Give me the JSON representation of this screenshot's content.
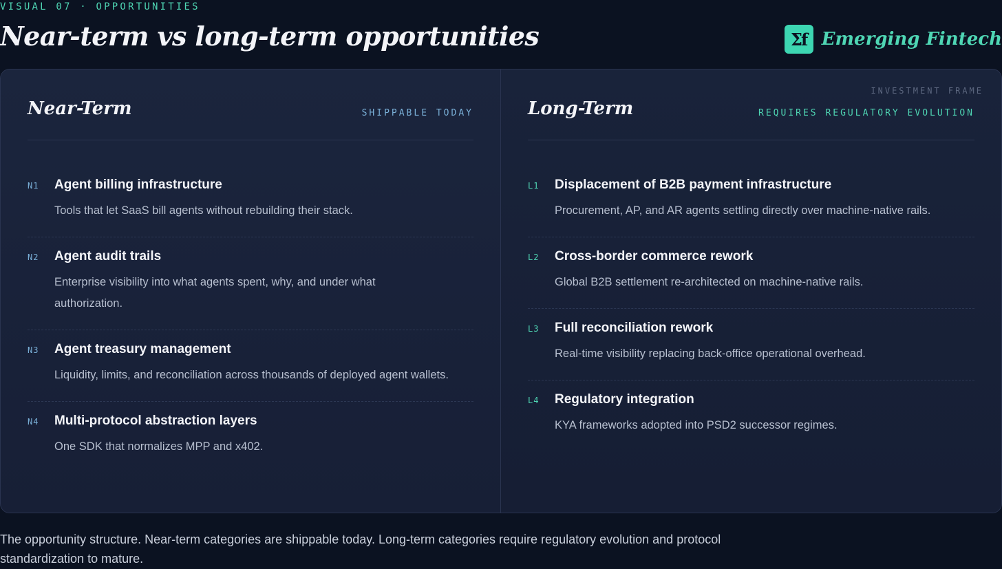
{
  "header": {
    "kicker": "VISUAL 07 · OPPORTUNITIES",
    "title": "Near-term vs long-term opportunities",
    "brand_logo_text": "Σf",
    "brand_name": "Emerging Fintech"
  },
  "panel": {
    "frame_label": "INVESTMENT FRAME",
    "near": {
      "title": "Near-Term",
      "tag": "SHIPPABLE TODAY",
      "items": [
        {
          "code": "N1",
          "title": "Agent billing infrastructure",
          "desc": "Tools that let SaaS bill agents without rebuilding their stack."
        },
        {
          "code": "N2",
          "title": "Agent audit trails",
          "desc": "Enterprise visibility into what agents spent, why, and under what authorization."
        },
        {
          "code": "N3",
          "title": "Agent treasury management",
          "desc": "Liquidity, limits, and reconciliation across thousands of deployed agent wallets."
        },
        {
          "code": "N4",
          "title": "Multi-protocol abstraction layers",
          "desc": "One SDK that normalizes MPP and x402."
        }
      ]
    },
    "long": {
      "title": "Long-Term",
      "tag": "REQUIRES REGULATORY EVOLUTION",
      "items": [
        {
          "code": "L1",
          "title": "Displacement of B2B payment infrastructure",
          "desc": "Procurement, AP, and AR agents settling directly over machine-native rails."
        },
        {
          "code": "L2",
          "title": "Cross-border commerce rework",
          "desc": "Global B2B settlement re-architected on machine-native rails."
        },
        {
          "code": "L3",
          "title": "Full reconciliation rework",
          "desc": "Real-time visibility replacing back-office operational overhead."
        },
        {
          "code": "L4",
          "title": "Regulatory integration",
          "desc": "KYA frameworks adopted into PSD2 successor regimes."
        }
      ]
    }
  },
  "caption": "The opportunity structure. Near-term categories are shippable today. Long-term categories require regulatory evolution and protocol standardization to mature.",
  "colors": {
    "background": "#0b1221",
    "panel": "#161f35",
    "accent_teal": "#4fd6b4",
    "accent_blue": "#7ab0d8",
    "text_primary": "#f3f4f8",
    "text_secondary": "#b7bfcf"
  }
}
